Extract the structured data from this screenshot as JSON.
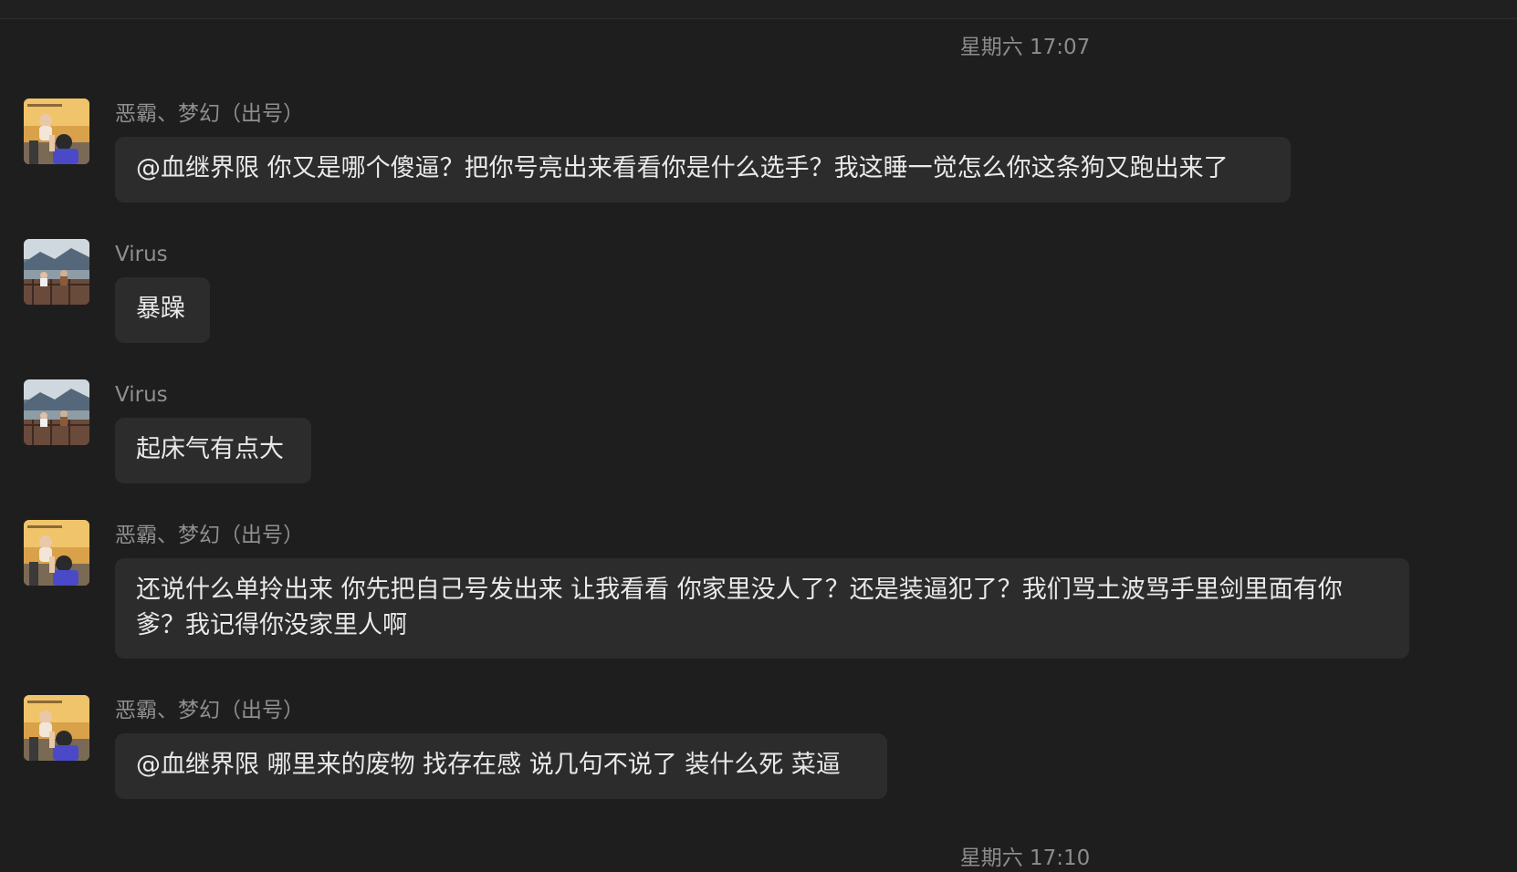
{
  "timestamps": {
    "first": "星期六 17:07",
    "second": "星期六 17:10"
  },
  "messages": [
    {
      "sender": "恶霸、梦幻（出号）",
      "avatar": "baby-held-up-avatar",
      "text": "@血继界限 你又是哪个傻逼？把你号亮出来看看你是什么选手？我这睡一觉怎么你这条狗又跑出来了"
    },
    {
      "sender": "Virus",
      "avatar": "mountain-balcony-avatar",
      "text": "暴躁"
    },
    {
      "sender": "Virus",
      "avatar": "mountain-balcony-avatar",
      "text": "起床气有点大"
    },
    {
      "sender": "恶霸、梦幻（出号）",
      "avatar": "baby-held-up-avatar",
      "text": "还说什么单拎出来 你先把自己号发出来 让我看看 你家里没人了？还是装逼犯了？我们骂土波骂手里剑里面有你爹？我记得你没家里人啊"
    },
    {
      "sender": "恶霸、梦幻（出号）",
      "avatar": "baby-held-up-avatar",
      "text": "@血继界限 哪里来的废物 找存在感 说几句不说了 装什么死 菜逼"
    }
  ],
  "colors": {
    "background": "#1e1e1e",
    "bubble": "#2c2c2c",
    "message_text": "#e9e9e9",
    "sender_text": "#8f8f8f",
    "timestamp_text": "#8c8c8c"
  }
}
